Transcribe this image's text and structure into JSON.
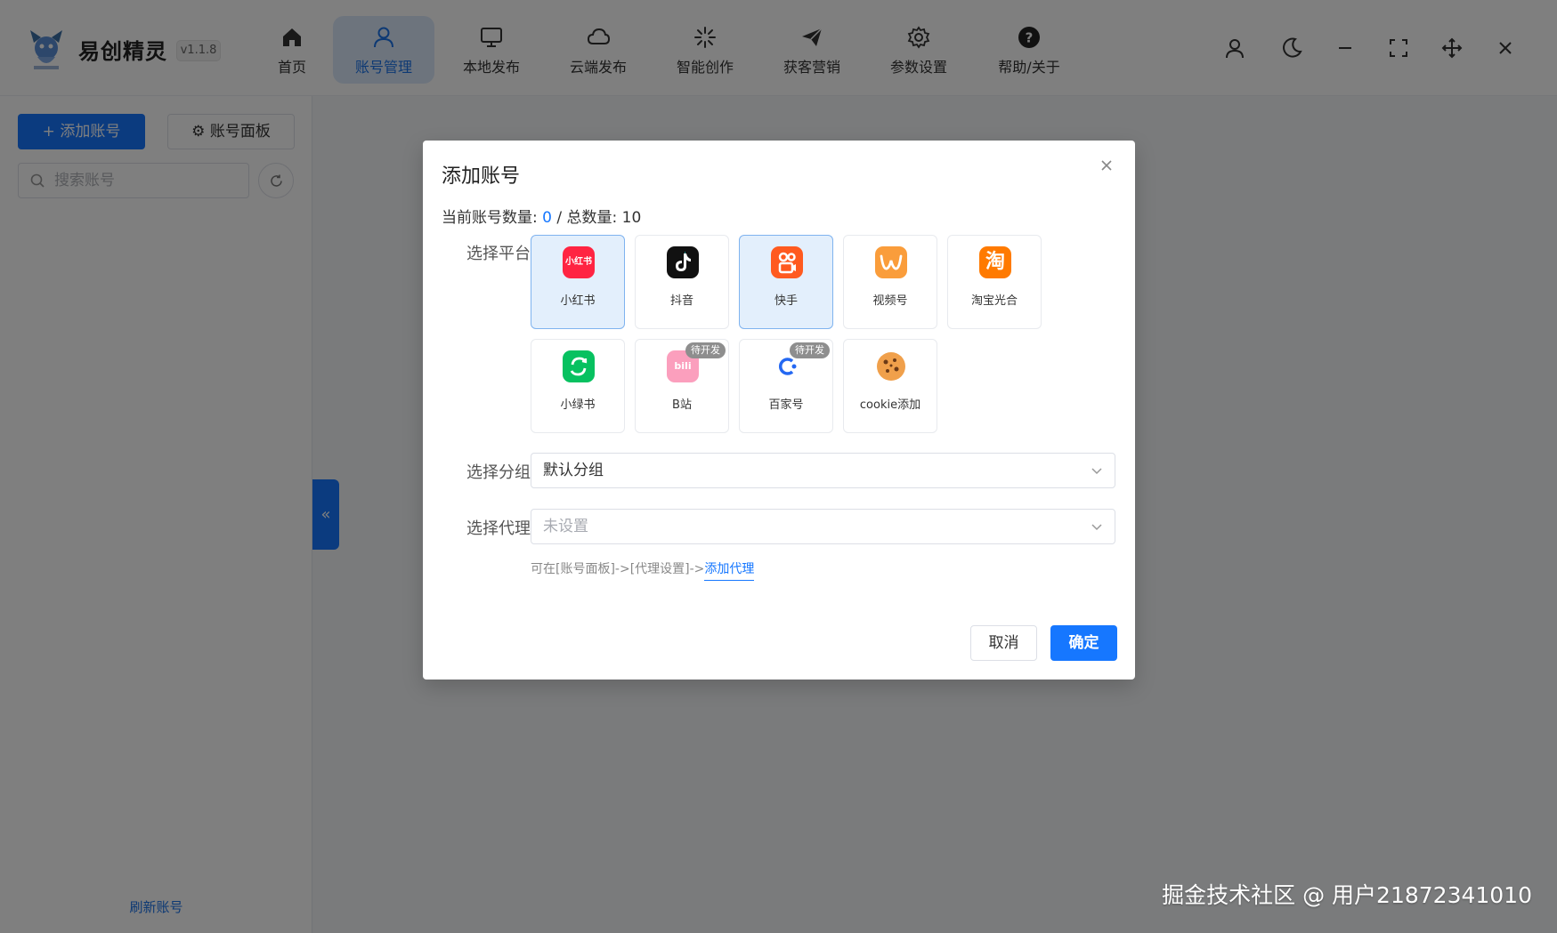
{
  "app": {
    "name": "易创精灵",
    "version": "v1.1.8"
  },
  "nav": {
    "items": [
      {
        "label": "首页",
        "icon": "home-icon"
      },
      {
        "label": "账号管理",
        "icon": "user-icon",
        "active": true
      },
      {
        "label": "本地发布",
        "icon": "monitor-icon"
      },
      {
        "label": "云端发布",
        "icon": "cloud-icon"
      },
      {
        "label": "智能创作",
        "icon": "sparkle-icon"
      },
      {
        "label": "获客营销",
        "icon": "send-icon"
      },
      {
        "label": "参数设置",
        "icon": "gear-icon"
      },
      {
        "label": "帮助/关于",
        "icon": "help-icon"
      }
    ]
  },
  "window_controls": [
    "profile-icon",
    "moon-icon",
    "minimize-icon",
    "fullscreen-icon",
    "move-icon",
    "close-icon"
  ],
  "sidebar": {
    "add_label": "添加账号",
    "panel_label": "账号面板",
    "search_placeholder": "搜索账号",
    "refresh_label": "刷新账号"
  },
  "dialog": {
    "title": "添加账号",
    "count_prefix": "当前账号数量: ",
    "count_current": "0",
    "count_sep": " / 总数量: ",
    "count_total": "10",
    "platform_label": "选择平台",
    "platforms": [
      {
        "name": "小红书",
        "selected": true,
        "color": "#ff2442"
      },
      {
        "name": "抖音",
        "selected": false,
        "color": "#111111"
      },
      {
        "name": "快手",
        "selected": true,
        "color": "#ff5a1f"
      },
      {
        "name": "视频号",
        "selected": false,
        "color": "#fa9d3b"
      },
      {
        "name": "淘宝光合",
        "selected": false,
        "color": "#ff6a00"
      },
      {
        "name": "小绿书",
        "selected": false,
        "color": "#07c160"
      },
      {
        "name": "B站",
        "selected": false,
        "badge": "待开发",
        "color": "#fb7299"
      },
      {
        "name": "百家号",
        "selected": false,
        "badge": "待开发",
        "color": "#2468f2"
      },
      {
        "name": "cookie添加",
        "selected": false,
        "color": "#e8892b"
      }
    ],
    "group_label": "选择分组",
    "group_value": "默认分组",
    "proxy_label": "选择代理",
    "proxy_placeholder": "未设置",
    "hint_prefix": "可在[账号面板]->[代理设置]->",
    "hint_link": "添加代理",
    "cancel_label": "取消",
    "ok_label": "确定",
    "icon_text_xhs": "小红书",
    "icon_text_taobao": "淘",
    "icon_text_bili": "bili"
  },
  "watermark": "掘金技术社区 @ 用户21872341010",
  "colors": {
    "accent": "#1677ff",
    "active_nav_bg": "#dbe9fb",
    "selected_platform_bg": "#e3effc"
  }
}
